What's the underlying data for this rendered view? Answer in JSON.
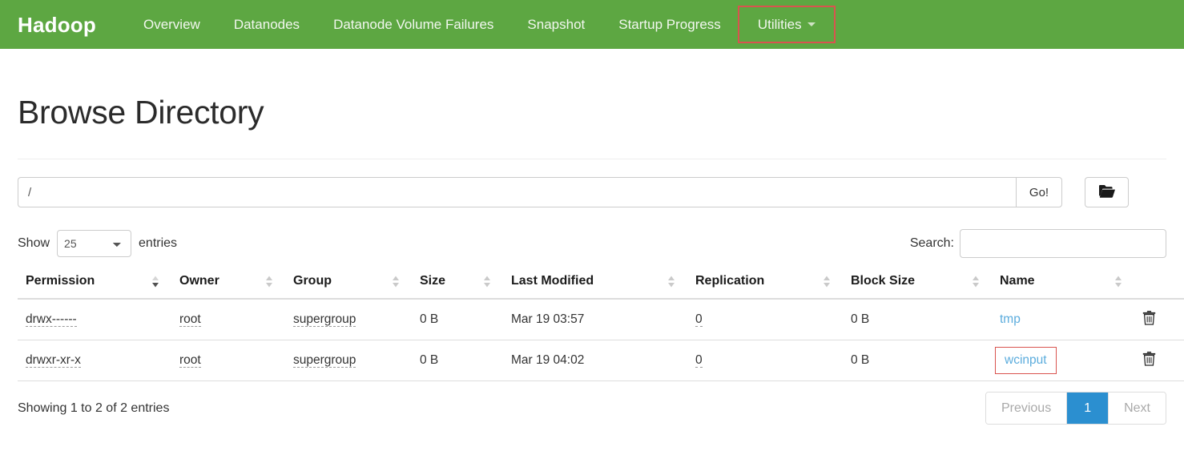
{
  "navbar": {
    "brand": "Hadoop",
    "bg_color": "#5da742",
    "items": [
      {
        "label": "Overview",
        "annotated": false
      },
      {
        "label": "Datanodes",
        "annotated": false
      },
      {
        "label": "Datanode Volume Failures",
        "annotated": false
      },
      {
        "label": "Snapshot",
        "annotated": false
      },
      {
        "label": "Startup Progress",
        "annotated": false
      },
      {
        "label": "Utilities",
        "annotated": true,
        "has_caret": true
      }
    ],
    "annotation_color": "#d9534f"
  },
  "page": {
    "title": "Browse Directory"
  },
  "path_bar": {
    "value": "/",
    "placeholder": "Enter path",
    "go_label": "Go!",
    "folder_icon": "open-folder-icon"
  },
  "controls": {
    "show_label": "Show",
    "entries_label": "entries",
    "page_length": "25",
    "page_length_options": [
      "25",
      "50",
      "100"
    ],
    "search_label": "Search:",
    "search_value": "",
    "search_placeholder": ""
  },
  "table": {
    "columns": [
      {
        "label": "Permission",
        "sort": "desc"
      },
      {
        "label": "Owner",
        "sort": "none"
      },
      {
        "label": "Group",
        "sort": "none"
      },
      {
        "label": "Size",
        "sort": "none"
      },
      {
        "label": "Last Modified",
        "sort": "none"
      },
      {
        "label": "Replication",
        "sort": "none"
      },
      {
        "label": "Block Size",
        "sort": "none"
      },
      {
        "label": "Name",
        "sort": "none"
      },
      {
        "label": "",
        "sort": "none"
      }
    ],
    "rows": [
      {
        "permission": "drwx------",
        "owner": "root",
        "group": "supergroup",
        "size": "0 B",
        "last_modified": "Mar 19 03:57",
        "replication": "0",
        "block_size": "0 B",
        "name": "tmp",
        "name_annotated": false,
        "delete_icon": "trash-icon"
      },
      {
        "permission": "drwxr-xr-x",
        "owner": "root",
        "group": "supergroup",
        "size": "0 B",
        "last_modified": "Mar 19 04:02",
        "replication": "0",
        "block_size": "0 B",
        "name": "wcinput",
        "name_annotated": true,
        "delete_icon": "trash-icon"
      }
    ]
  },
  "footer": {
    "info": "Showing 1 to 2 of 2 entries",
    "previous_label": "Previous",
    "current_page": "1",
    "next_label": "Next",
    "active_page_color": "#2b8fd0"
  }
}
